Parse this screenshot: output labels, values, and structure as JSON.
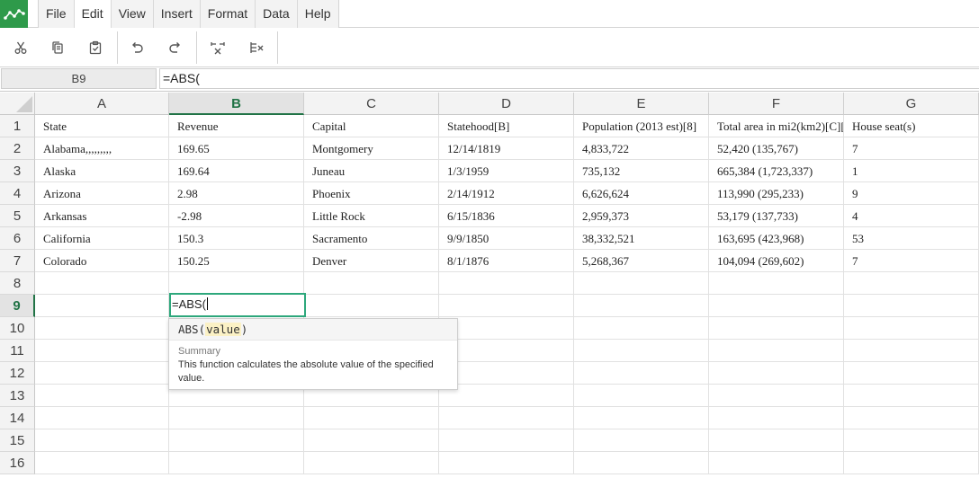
{
  "menu": {
    "items": [
      {
        "label": "File"
      },
      {
        "label": "Edit"
      },
      {
        "label": "View"
      },
      {
        "label": "Insert"
      },
      {
        "label": "Format"
      },
      {
        "label": "Data"
      },
      {
        "label": "Help"
      }
    ],
    "active": "Edit"
  },
  "toolbar": {
    "buttons": [
      "cut-icon",
      "copy-icon",
      "paste-icon",
      "undo-icon",
      "redo-icon",
      "merge-cells-icon",
      "unmerge-cells-icon"
    ]
  },
  "formula_bar": {
    "cell_ref": "B9",
    "formula": "=ABS("
  },
  "sheet": {
    "columns": [
      "A",
      "B",
      "C",
      "D",
      "E",
      "F",
      "G"
    ],
    "selected_column": "B",
    "row_numbers": [
      "1",
      "2",
      "3",
      "4",
      "5",
      "6",
      "7",
      "8",
      "9",
      "10",
      "11",
      "12",
      "13",
      "14",
      "15",
      "16"
    ],
    "selected_row": "9",
    "rows": [
      [
        "State",
        "Revenue",
        "Capital",
        "Statehood[B]",
        "Population (2013 est)[8]",
        "Total area in mi2(km2)[C][",
        "House seat(s)"
      ],
      [
        "Alabama,,,,,,,,,",
        "169.65",
        "Montgomery",
        "12/14/1819",
        "4,833,722",
        "52,420 (135,767)",
        "7"
      ],
      [
        "Alaska",
        "169.64",
        "Juneau",
        "1/3/1959",
        "735,132",
        "665,384 (1,723,337)",
        "1"
      ],
      [
        "Arizona",
        "2.98",
        "Phoenix",
        "2/14/1912",
        "6,626,624",
        "113,990 (295,233)",
        "9"
      ],
      [
        "Arkansas",
        "-2.98",
        "Little Rock",
        "6/15/1836",
        "2,959,373",
        "53,179 (137,733)",
        "4"
      ],
      [
        "California",
        "150.3",
        "Sacramento",
        "9/9/1850",
        "38,332,521",
        "163,695 (423,968)",
        "53"
      ],
      [
        "Colorado",
        "150.25",
        "Denver",
        "8/1/1876",
        "5,268,367",
        "104,094 (269,602)",
        "7"
      ]
    ],
    "editing_value": "=ABS("
  },
  "function_tip": {
    "name": "ABS",
    "open_paren": "(",
    "arg": "value",
    "close_paren": ")",
    "summary_label": "Summary",
    "description": "This function calculates the absolute value of the specified value."
  },
  "colors": {
    "accent_green": "#217346",
    "editor_border": "#2ea87c",
    "logo_green": "#2e9a4a"
  }
}
